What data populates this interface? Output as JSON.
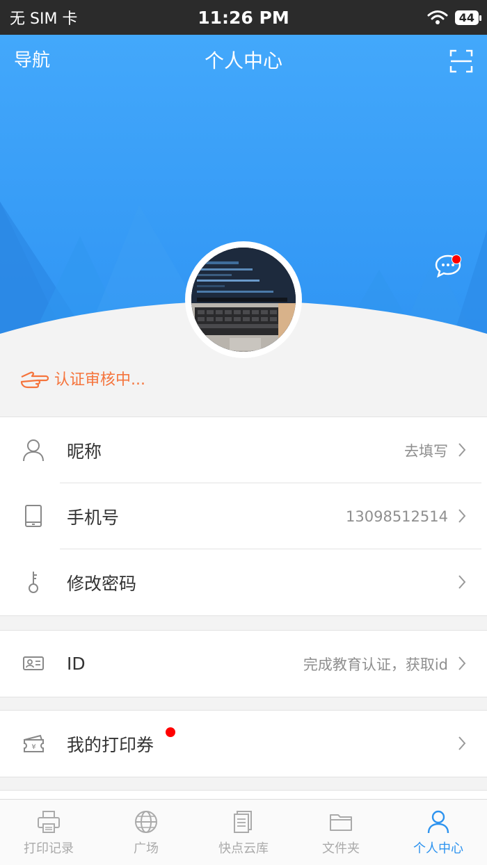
{
  "status_bar": {
    "carrier": "无 SIM 卡",
    "time": "11:26 PM",
    "battery": "44"
  },
  "header": {
    "nav_label": "导航",
    "title": "个人中心"
  },
  "profile": {
    "verify_text": "认证审核中..."
  },
  "account_group": [
    {
      "label": "昵称",
      "value": "去填写",
      "icon": "user-icon"
    },
    {
      "label": "手机号",
      "value": "13098512514",
      "icon": "phone-icon"
    },
    {
      "label": "修改密码",
      "value": "",
      "icon": "key-icon"
    }
  ],
  "id_row": {
    "label": "ID",
    "value": "完成教育认证，获取id",
    "icon": "id-card-icon"
  },
  "coupon_row": {
    "label": "我的打印券",
    "icon": "ticket-icon"
  },
  "tabs": [
    {
      "label": "打印记录",
      "icon": "printer-icon"
    },
    {
      "label": "广场",
      "icon": "globe-icon"
    },
    {
      "label": "快点云库",
      "icon": "document-icon"
    },
    {
      "label": "文件夹",
      "icon": "folder-icon"
    },
    {
      "label": "个人中心",
      "icon": "person-icon",
      "active": true
    }
  ],
  "colors": {
    "primary": "#2d93ef",
    "hero": "#43a8fb",
    "warning": "#f5743c",
    "badge": "#ff0000"
  }
}
